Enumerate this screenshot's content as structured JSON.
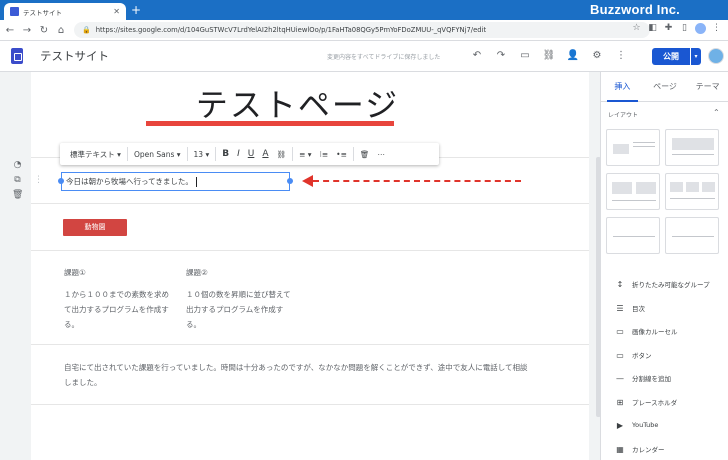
{
  "browser": {
    "tab_title": "テストサイト",
    "new_tab": "+",
    "brand": "Buzzword Inc.",
    "url": "https://sites.google.com/d/104GuSTWcV7LrdYelAI2h2ltqHUiewlOo/p/1FaHTa08QGy5PmYoFDoZMUU-_qVQFYNj7/edit"
  },
  "header": {
    "site_name": "テストサイト",
    "save_status": "変更内容をすべてドライブに保存しました",
    "publish_label": "公開"
  },
  "page": {
    "title": "テストページ",
    "title_underline_color": "#e8453c",
    "textbox_text": "今日は朝から牧場へ行ってきました。",
    "button_label": "動物園",
    "task1_heading": "課題①",
    "task1_body": "１から１００までの素数を求めて出力するプログラムを作成する。",
    "task2_heading": "課題②",
    "task2_body": "１０個の数を昇順に並び替えて出力するプログラムを作成する。",
    "paragraph": "自宅にて出されていた課題を行っていました。時間は十分あったのですが、なかなか問題を解くことができず、途中で友人に電話して相談しました。"
  },
  "format_bar": {
    "style": "標準テキスト ▾",
    "font": "Open Sans ▾",
    "size": "13 ▾",
    "bold": "B",
    "italic": "I",
    "underline": "U",
    "text_color": "A",
    "link": "⛓",
    "align": "≡ ▾",
    "numbered": "⁝≡",
    "bulleted": "•≡",
    "clear": "🗑",
    "more": "⋯"
  },
  "panel": {
    "tabs": [
      "挿入",
      "ページ",
      "テーマ"
    ],
    "layout_header": "レイアウト",
    "components": [
      {
        "icon": "expand-icon",
        "glyph": "↕",
        "label": "折りたたみ可能なグループ"
      },
      {
        "icon": "toc-icon",
        "glyph": "☰",
        "label": "目次"
      },
      {
        "icon": "carousel-icon",
        "glyph": "▭",
        "label": "画像カルーセル"
      },
      {
        "icon": "button-icon",
        "glyph": "▭",
        "label": "ボタン"
      },
      {
        "icon": "divider-icon",
        "glyph": "—",
        "label": "分割線を追加"
      },
      {
        "icon": "placeholder-icon",
        "glyph": "⊞",
        "label": "プレースホルダ"
      },
      {
        "icon": "youtube-icon",
        "glyph": "▶",
        "label": "YouTube"
      },
      {
        "icon": "calendar-icon",
        "glyph": "▦",
        "label": "カレンダー"
      }
    ]
  },
  "colors": {
    "accent": "#1a57d2",
    "tabbar": "#1b6fc5",
    "button": "#d24541",
    "arrow": "#e0342b",
    "selection": "#4a8cf4"
  }
}
